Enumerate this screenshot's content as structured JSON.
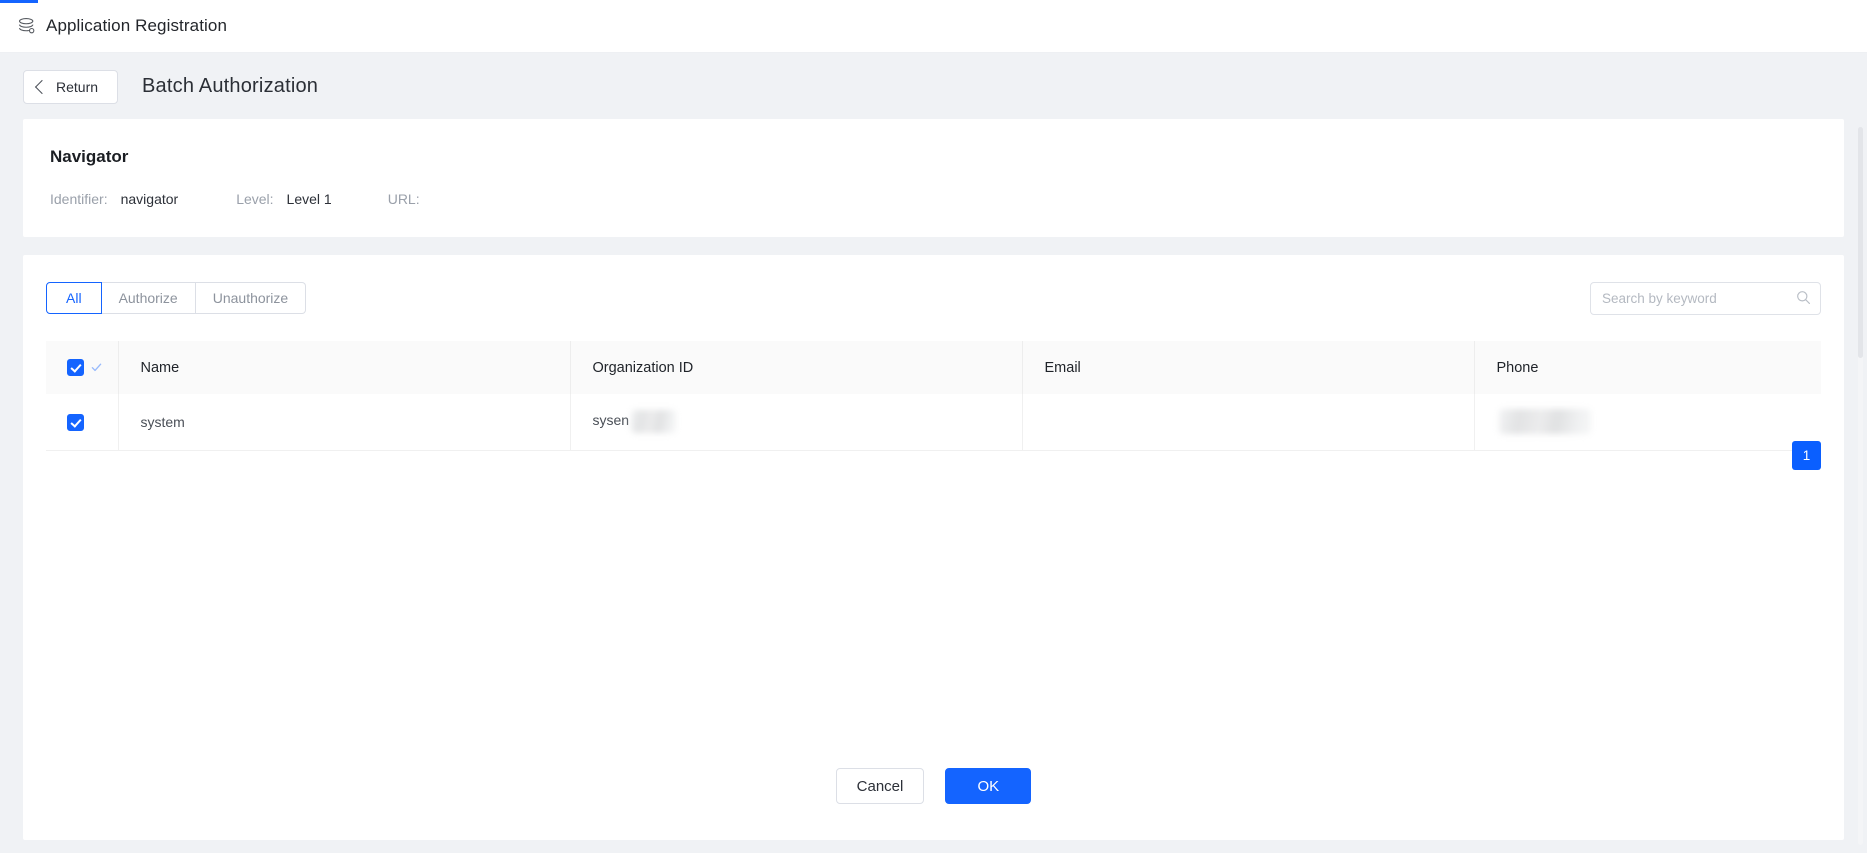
{
  "colors": {
    "accent": "#1464ff",
    "page_bg": "#f0f2f5",
    "card_bg": "#ffffff",
    "header_row_bg": "#fafafa",
    "muted_text": "#9aa0aa",
    "primary_text": "#2c3038"
  },
  "app": {
    "logo_icon": "layers-stack-icon",
    "title": "Application Registration"
  },
  "subheader": {
    "return_label": "Return",
    "back_icon": "chevron-left-icon",
    "page_heading": "Batch Authorization"
  },
  "info": {
    "title": "Navigator",
    "fields": [
      {
        "label": "Identifier:",
        "value": "navigator"
      },
      {
        "label": "Level:",
        "value": "Level 1"
      },
      {
        "label": "URL:",
        "value": ""
      }
    ]
  },
  "toolbar": {
    "tabs": [
      {
        "label": "All",
        "active": true
      },
      {
        "label": "Authorize",
        "active": false
      },
      {
        "label": "Unauthorize",
        "active": false
      }
    ],
    "search": {
      "placeholder": "Search by keyword",
      "value": "",
      "icon": "search-icon"
    }
  },
  "table": {
    "select_all_checked": true,
    "select_all_secondary_icon": "check-mark-icon",
    "columns": [
      {
        "key": "name",
        "label": "Name"
      },
      {
        "key": "organization_id",
        "label": "Organization ID"
      },
      {
        "key": "email",
        "label": "Email"
      },
      {
        "key": "phone",
        "label": "Phone"
      }
    ],
    "rows": [
      {
        "checked": true,
        "name": "system",
        "organization_id": "sysen",
        "organization_id_redacted": true,
        "email": "",
        "phone": "",
        "phone_redacted": true
      }
    ]
  },
  "pagination": {
    "pages": [
      {
        "label": "1",
        "active": true
      }
    ]
  },
  "footer": {
    "cancel_label": "Cancel",
    "ok_label": "OK"
  }
}
